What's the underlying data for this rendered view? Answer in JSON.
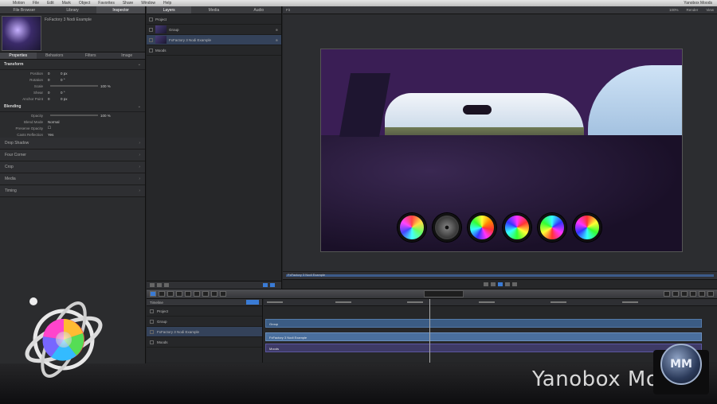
{
  "menubar": {
    "apple": "",
    "items": [
      "Motion",
      "File",
      "Edit",
      "Mark",
      "Object",
      "Favorites",
      "Share",
      "Window",
      "Help"
    ],
    "right": "Yanobox Moods"
  },
  "left_panel": {
    "tabs": [
      "File Browser",
      "Library",
      "Inspector"
    ],
    "preview_name": "FxFactory 3 Nodi Example",
    "inspector_tabs": [
      "Properties",
      "Behaviors",
      "Filters",
      "Image"
    ],
    "transform_label": "Transform",
    "transform_rows": [
      {
        "label": "Position",
        "val": "0",
        "val2": "0 px"
      },
      {
        "label": "Rotation",
        "val": "0",
        "val2": "0 °"
      },
      {
        "label": "Scale",
        "val": "",
        "val2": "100 %"
      },
      {
        "label": "Shear",
        "val": "0",
        "val2": "0 °"
      },
      {
        "label": "Anchor Point",
        "val": "0",
        "val2": "0 px"
      }
    ],
    "blending_label": "Blending",
    "blending_rows": [
      {
        "label": "Opacity",
        "val": "",
        "val2": "100 %"
      },
      {
        "label": "Blend Mode",
        "val": "Normal",
        "val2": ""
      },
      {
        "label": "Preserve Opacity",
        "val": "",
        "val2": ""
      },
      {
        "label": "Casts Reflection",
        "val": "Yes",
        "val2": ""
      }
    ],
    "collapsed_sections": [
      "Drop Shadow",
      "Four Corner",
      "Crop",
      "Media",
      "Timing"
    ]
  },
  "layers_panel": {
    "tabs": [
      "Layers",
      "Media",
      "Audio"
    ],
    "rows": [
      {
        "name": "Project",
        "tag": ""
      },
      {
        "name": "Group",
        "tag": "⊕"
      },
      {
        "name": "FxFactory 3 Nodi Example",
        "tag": "⊕"
      },
      {
        "name": "Moods",
        "tag": ""
      }
    ]
  },
  "canvas": {
    "zoom": "Fit",
    "options": [
      "100%",
      "Render",
      "View"
    ],
    "mini_timeline_label": "FxFactory 3 Nodi Example"
  },
  "timeline": {
    "title": "Timeline",
    "rows": [
      {
        "name": "Project"
      },
      {
        "name": "Group"
      },
      {
        "name": "FxFactory 3 Nodi Example"
      },
      {
        "name": "Moods"
      }
    ],
    "track_labels": [
      "Group",
      "FxFactory 3 Nodi Example",
      "Moods"
    ]
  },
  "watermark": {
    "text": "Yanobox Moods",
    "badge": "MM"
  },
  "colors": {
    "accent": "#3a7bd5",
    "video_tint": "#3a1e55",
    "selection": "#34425a"
  }
}
